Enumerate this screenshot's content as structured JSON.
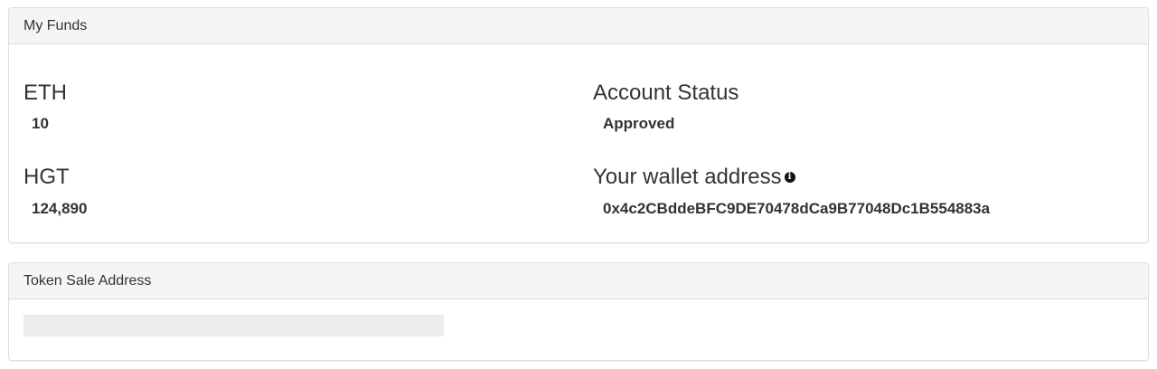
{
  "funds": {
    "title": "My Funds",
    "eth_label": "ETH",
    "eth_value": "10",
    "hgt_label": "HGT",
    "hgt_value": "124,890",
    "status_label": "Account Status",
    "status_value": "Approved",
    "wallet_label": "Your wallet address",
    "wallet_value": "0x4c2CBddeBFC9DE70478dCa9B77048Dc1B554883a",
    "info_icon": "info-circle-icon"
  },
  "token_sale": {
    "title": "Token Sale Address"
  }
}
